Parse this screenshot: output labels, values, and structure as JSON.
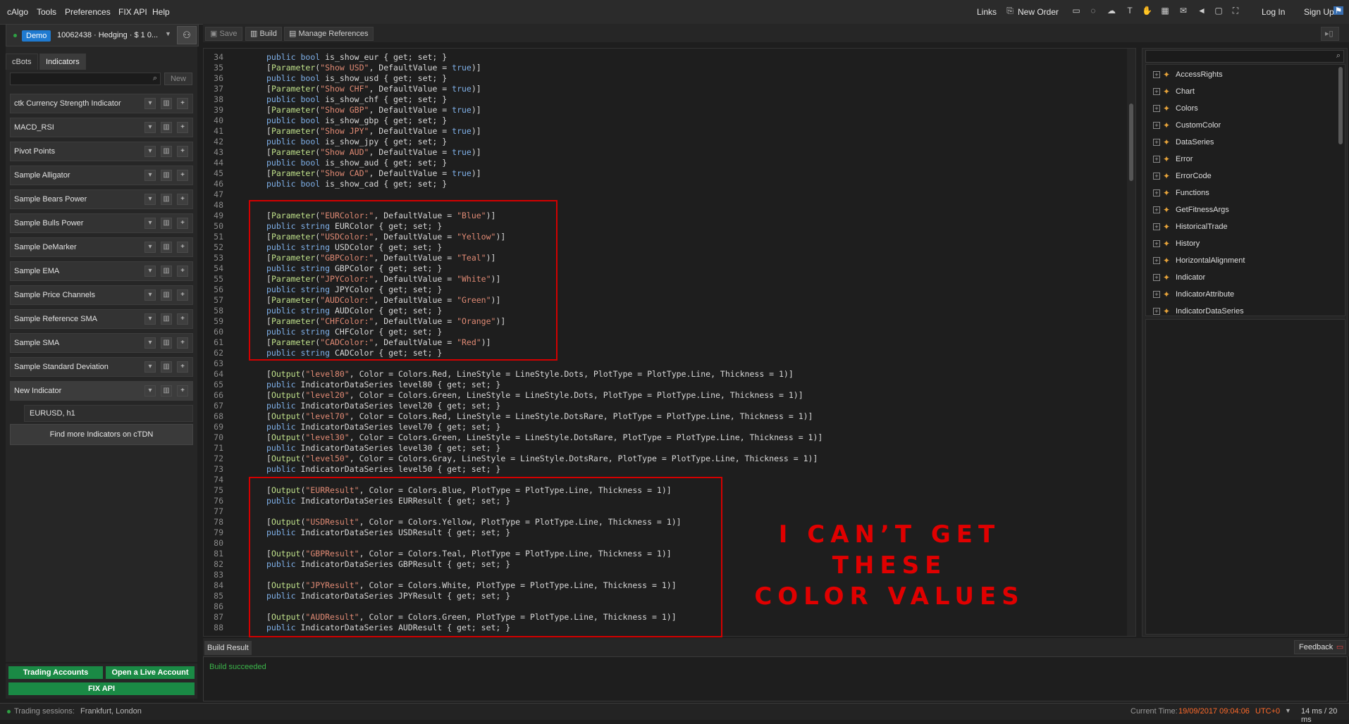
{
  "menubar": {
    "items": [
      "cAlgo",
      "Tools",
      "Preferences",
      "FIX API",
      "Help"
    ],
    "links": "Links",
    "new_order": "New Order",
    "log_in": "Log In",
    "sign_up": "Sign Up"
  },
  "account": {
    "badge": "Demo",
    "text": "10062438 · Hedging · $ 1 0..."
  },
  "tabs": [
    "cBots",
    "Indicators"
  ],
  "left_search": {
    "new_label": "New"
  },
  "indicators": [
    "ctk Currency Strength Indicator",
    "MACD_RSI",
    "Pivot Points",
    "Sample Alligator",
    "Sample Bears Power",
    "Sample Bulls Power",
    "Sample DeMarker",
    "Sample EMA",
    "Sample Price Channels",
    "Sample Reference SMA",
    "Sample SMA",
    "Sample Standard Deviation",
    "New Indicator"
  ],
  "instance": "EURUSD, h1",
  "find_more": "Find more Indicators on cTDN",
  "toolbar": {
    "save": "Save",
    "build": "Build",
    "manage_refs": "Manage References"
  },
  "code": [
    {
      "n": "34",
      "t": "public bool is_show_eur { get; set; }"
    },
    {
      "n": "35",
      "t": "[Parameter(\"Show USD\", DefaultValue = true)]"
    },
    {
      "n": "36",
      "t": "public bool is_show_usd { get; set; }"
    },
    {
      "n": "37",
      "t": "[Parameter(\"Show CHF\", DefaultValue = true)]"
    },
    {
      "n": "38",
      "t": "public bool is_show_chf { get; set; }"
    },
    {
      "n": "39",
      "t": "[Parameter(\"Show GBP\", DefaultValue = true)]"
    },
    {
      "n": "40",
      "t": "public bool is_show_gbp { get; set; }"
    },
    {
      "n": "41",
      "t": "[Parameter(\"Show JPY\", DefaultValue = true)]"
    },
    {
      "n": "42",
      "t": "public bool is_show_jpy { get; set; }"
    },
    {
      "n": "43",
      "t": "[Parameter(\"Show AUD\", DefaultValue = true)]"
    },
    {
      "n": "44",
      "t": "public bool is_show_aud { get; set; }"
    },
    {
      "n": "45",
      "t": "[Parameter(\"Show CAD\", DefaultValue = true)]"
    },
    {
      "n": "46",
      "t": "public bool is_show_cad { get; set; }"
    },
    {
      "n": "47",
      "t": ""
    },
    {
      "n": "48",
      "t": ""
    },
    {
      "n": "49",
      "t": "[Parameter(\"EURColor:\", DefaultValue = \"Blue\")]"
    },
    {
      "n": "50",
      "t": "public string EURColor { get; set; }"
    },
    {
      "n": "51",
      "t": "[Parameter(\"USDColor:\", DefaultValue = \"Yellow\")]"
    },
    {
      "n": "52",
      "t": "public string USDColor { get; set; }"
    },
    {
      "n": "53",
      "t": "[Parameter(\"GBPColor:\", DefaultValue = \"Teal\")]"
    },
    {
      "n": "54",
      "t": "public string GBPColor { get; set; }"
    },
    {
      "n": "55",
      "t": "[Parameter(\"JPYColor:\", DefaultValue = \"White\")]"
    },
    {
      "n": "56",
      "t": "public string JPYColor { get; set; }"
    },
    {
      "n": "57",
      "t": "[Parameter(\"AUDColor:\", DefaultValue = \"Green\")]"
    },
    {
      "n": "58",
      "t": "public string AUDColor { get; set; }"
    },
    {
      "n": "59",
      "t": "[Parameter(\"CHFColor:\", DefaultValue = \"Orange\")]"
    },
    {
      "n": "60",
      "t": "public string CHFColor { get; set; }"
    },
    {
      "n": "61",
      "t": "[Parameter(\"CADColor:\", DefaultValue = \"Red\")]"
    },
    {
      "n": "62",
      "t": "public string CADColor { get; set; }"
    },
    {
      "n": "63",
      "t": ""
    },
    {
      "n": "64",
      "t": "[Output(\"level80\", Color = Colors.Red, LineStyle = LineStyle.Dots, PlotType = PlotType.Line, Thickness = 1)]"
    },
    {
      "n": "65",
      "t": "public IndicatorDataSeries level80 { get; set; }"
    },
    {
      "n": "66",
      "t": "[Output(\"level20\", Color = Colors.Green, LineStyle = LineStyle.Dots, PlotType = PlotType.Line, Thickness = 1)]"
    },
    {
      "n": "67",
      "t": "public IndicatorDataSeries level20 { get; set; }"
    },
    {
      "n": "68",
      "t": "[Output(\"level70\", Color = Colors.Red, LineStyle = LineStyle.DotsRare, PlotType = PlotType.Line, Thickness = 1)]"
    },
    {
      "n": "69",
      "t": "public IndicatorDataSeries level70 { get; set; }"
    },
    {
      "n": "70",
      "t": "[Output(\"level30\", Color = Colors.Green, LineStyle = LineStyle.DotsRare, PlotType = PlotType.Line, Thickness = 1)]"
    },
    {
      "n": "71",
      "t": "public IndicatorDataSeries level30 { get; set; }"
    },
    {
      "n": "72",
      "t": "[Output(\"level50\", Color = Colors.Gray, LineStyle = LineStyle.DotsRare, PlotType = PlotType.Line, Thickness = 1)]"
    },
    {
      "n": "73",
      "t": "public IndicatorDataSeries level50 { get; set; }"
    },
    {
      "n": "74",
      "t": ""
    },
    {
      "n": "75",
      "t": "[Output(\"EURResult\", Color = Colors.Blue, PlotType = PlotType.Line, Thickness = 1)]"
    },
    {
      "n": "76",
      "t": "public IndicatorDataSeries EURResult { get; set; }"
    },
    {
      "n": "77",
      "t": ""
    },
    {
      "n": "78",
      "t": "[Output(\"USDResult\", Color = Colors.Yellow, PlotType = PlotType.Line, Thickness = 1)]"
    },
    {
      "n": "79",
      "t": "public IndicatorDataSeries USDResult { get; set; }"
    },
    {
      "n": "80",
      "t": ""
    },
    {
      "n": "81",
      "t": "[Output(\"GBPResult\", Color = Colors.Teal, PlotType = PlotType.Line, Thickness = 1)]"
    },
    {
      "n": "82",
      "t": "public IndicatorDataSeries GBPResult { get; set; }"
    },
    {
      "n": "83",
      "t": ""
    },
    {
      "n": "84",
      "t": "[Output(\"JPYResult\", Color = Colors.White, PlotType = PlotType.Line, Thickness = 1)]"
    },
    {
      "n": "85",
      "t": "public IndicatorDataSeries JPYResult { get; set; }"
    },
    {
      "n": "86",
      "t": ""
    },
    {
      "n": "87",
      "t": "[Output(\"AUDResult\", Color = Colors.Green, PlotType = PlotType.Line, Thickness = 1)]"
    },
    {
      "n": "88",
      "t": "public IndicatorDataSeries AUDResult { get; set; }"
    }
  ],
  "annotation": {
    "line1": "I CAN’T GET THESE",
    "line2": "COLOR VALUES"
  },
  "tree": [
    "AccessRights",
    "Chart",
    "Colors",
    "CustomColor",
    "DataSeries",
    "Error",
    "ErrorCode",
    "Functions",
    "GetFitnessArgs",
    "HistoricalTrade",
    "History",
    "HorizontalAlignment",
    "Indicator",
    "IndicatorAttribute",
    "IndicatorDataSeries"
  ],
  "build": {
    "tab": "Build Result",
    "feedback": "Feedback",
    "output": "Build succeeded"
  },
  "bottom_buttons": {
    "trading_accounts": "Trading Accounts",
    "open_live": "Open a Live Account",
    "fix_api": "FIX API"
  },
  "status": {
    "sessions_label": "Trading sessions:",
    "sessions": "Frankfurt, London",
    "time_label": "Current Time:",
    "time": "19/09/2017 09:04:06",
    "tz": "UTC+0",
    "latency": "14 ms / 20 ms"
  },
  "colors": {
    "accent": "#1f7ad0",
    "annotation": "#d40000",
    "success": "#2ea043",
    "green_button": "#1a8a45"
  }
}
